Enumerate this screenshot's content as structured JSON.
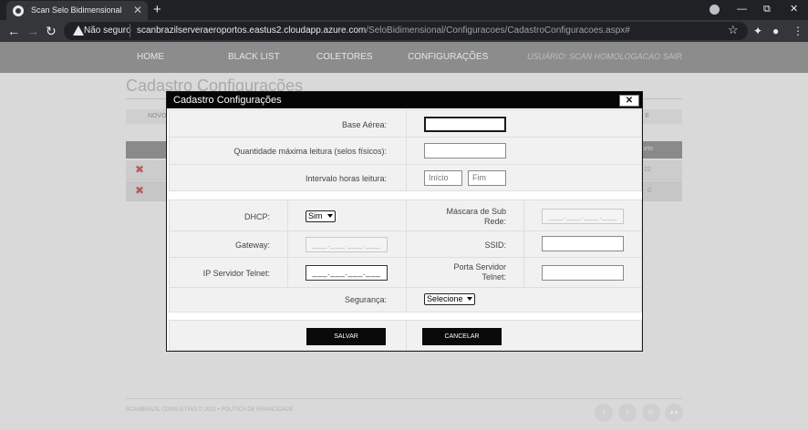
{
  "browser": {
    "tab_title": "Scan Selo Bidimensional",
    "tab_close": "✕",
    "new_tab": "+",
    "win_min": "—",
    "win_restore": "⧉",
    "win_close": "✕",
    "back": "←",
    "forward": "→",
    "reload": "↻",
    "insecure_label": "Não seguro",
    "url_host": "scanbrazilserveraeroportos.eastus2.cloudapp.azure.com",
    "url_path": "/SeloBidimensional/Configuracoes/CadastroConfiguracoes.aspx#",
    "star": "☆",
    "extensions": "✦",
    "profile": "●",
    "menu": "⋮"
  },
  "nav": {
    "home": "HOME",
    "blacklist": "BLACK LIST",
    "coletores": "COLETORES",
    "configuracoes": "CONFIGURAÇÕES",
    "user": "USUÁRIO: SCAN HOMOLOGACAO",
    "sair": "SAIR"
  },
  "background": {
    "page_title": "Cadastro Configurações",
    "novo": "NOVO",
    "e": "E",
    "header_right": "orto",
    "row1_right": "22",
    "row2_right": "0",
    "delete_glyph": "✖",
    "footer": "SCANBRAZIL CONSULTING © 2021 • POLÍTICA DE PRIVACIDADE",
    "social": [
      "t",
      "f",
      "in",
      "●●"
    ]
  },
  "modal": {
    "title": "Cadastro Configurações",
    "close": "✕",
    "base_aerea_label": "Base Aérea:",
    "base_aerea_value": "",
    "qtd_label": "Quantidade máxima leitura (selos físicos):",
    "qtd_value": "",
    "intervalo_label": "Intervalo horas leitura:",
    "inicio_placeholder": "Início",
    "fim_placeholder": "Fim",
    "dhcp_label": "DHCP:",
    "dhcp_value": "Sim",
    "mascara_label_1": "Máscara de Sub",
    "mascara_label_2": "Rede:",
    "mascara_value": "___.___.___.___",
    "gateway_label": "Gateway:",
    "gateway_value": "___.___.___.___",
    "ssid_label": "SSID:",
    "ssid_value": "",
    "ip_telnet_label": "IP Servidor Telnet:",
    "ip_telnet_value": "___.___.___.___",
    "porta_label_1": "Porta Servidor",
    "porta_label_2": "Telnet:",
    "porta_value": "",
    "seguranca_label": "Segurança:",
    "seguranca_value": "Selecione",
    "salvar": "SALVAR",
    "cancelar": "CANCELAR"
  }
}
